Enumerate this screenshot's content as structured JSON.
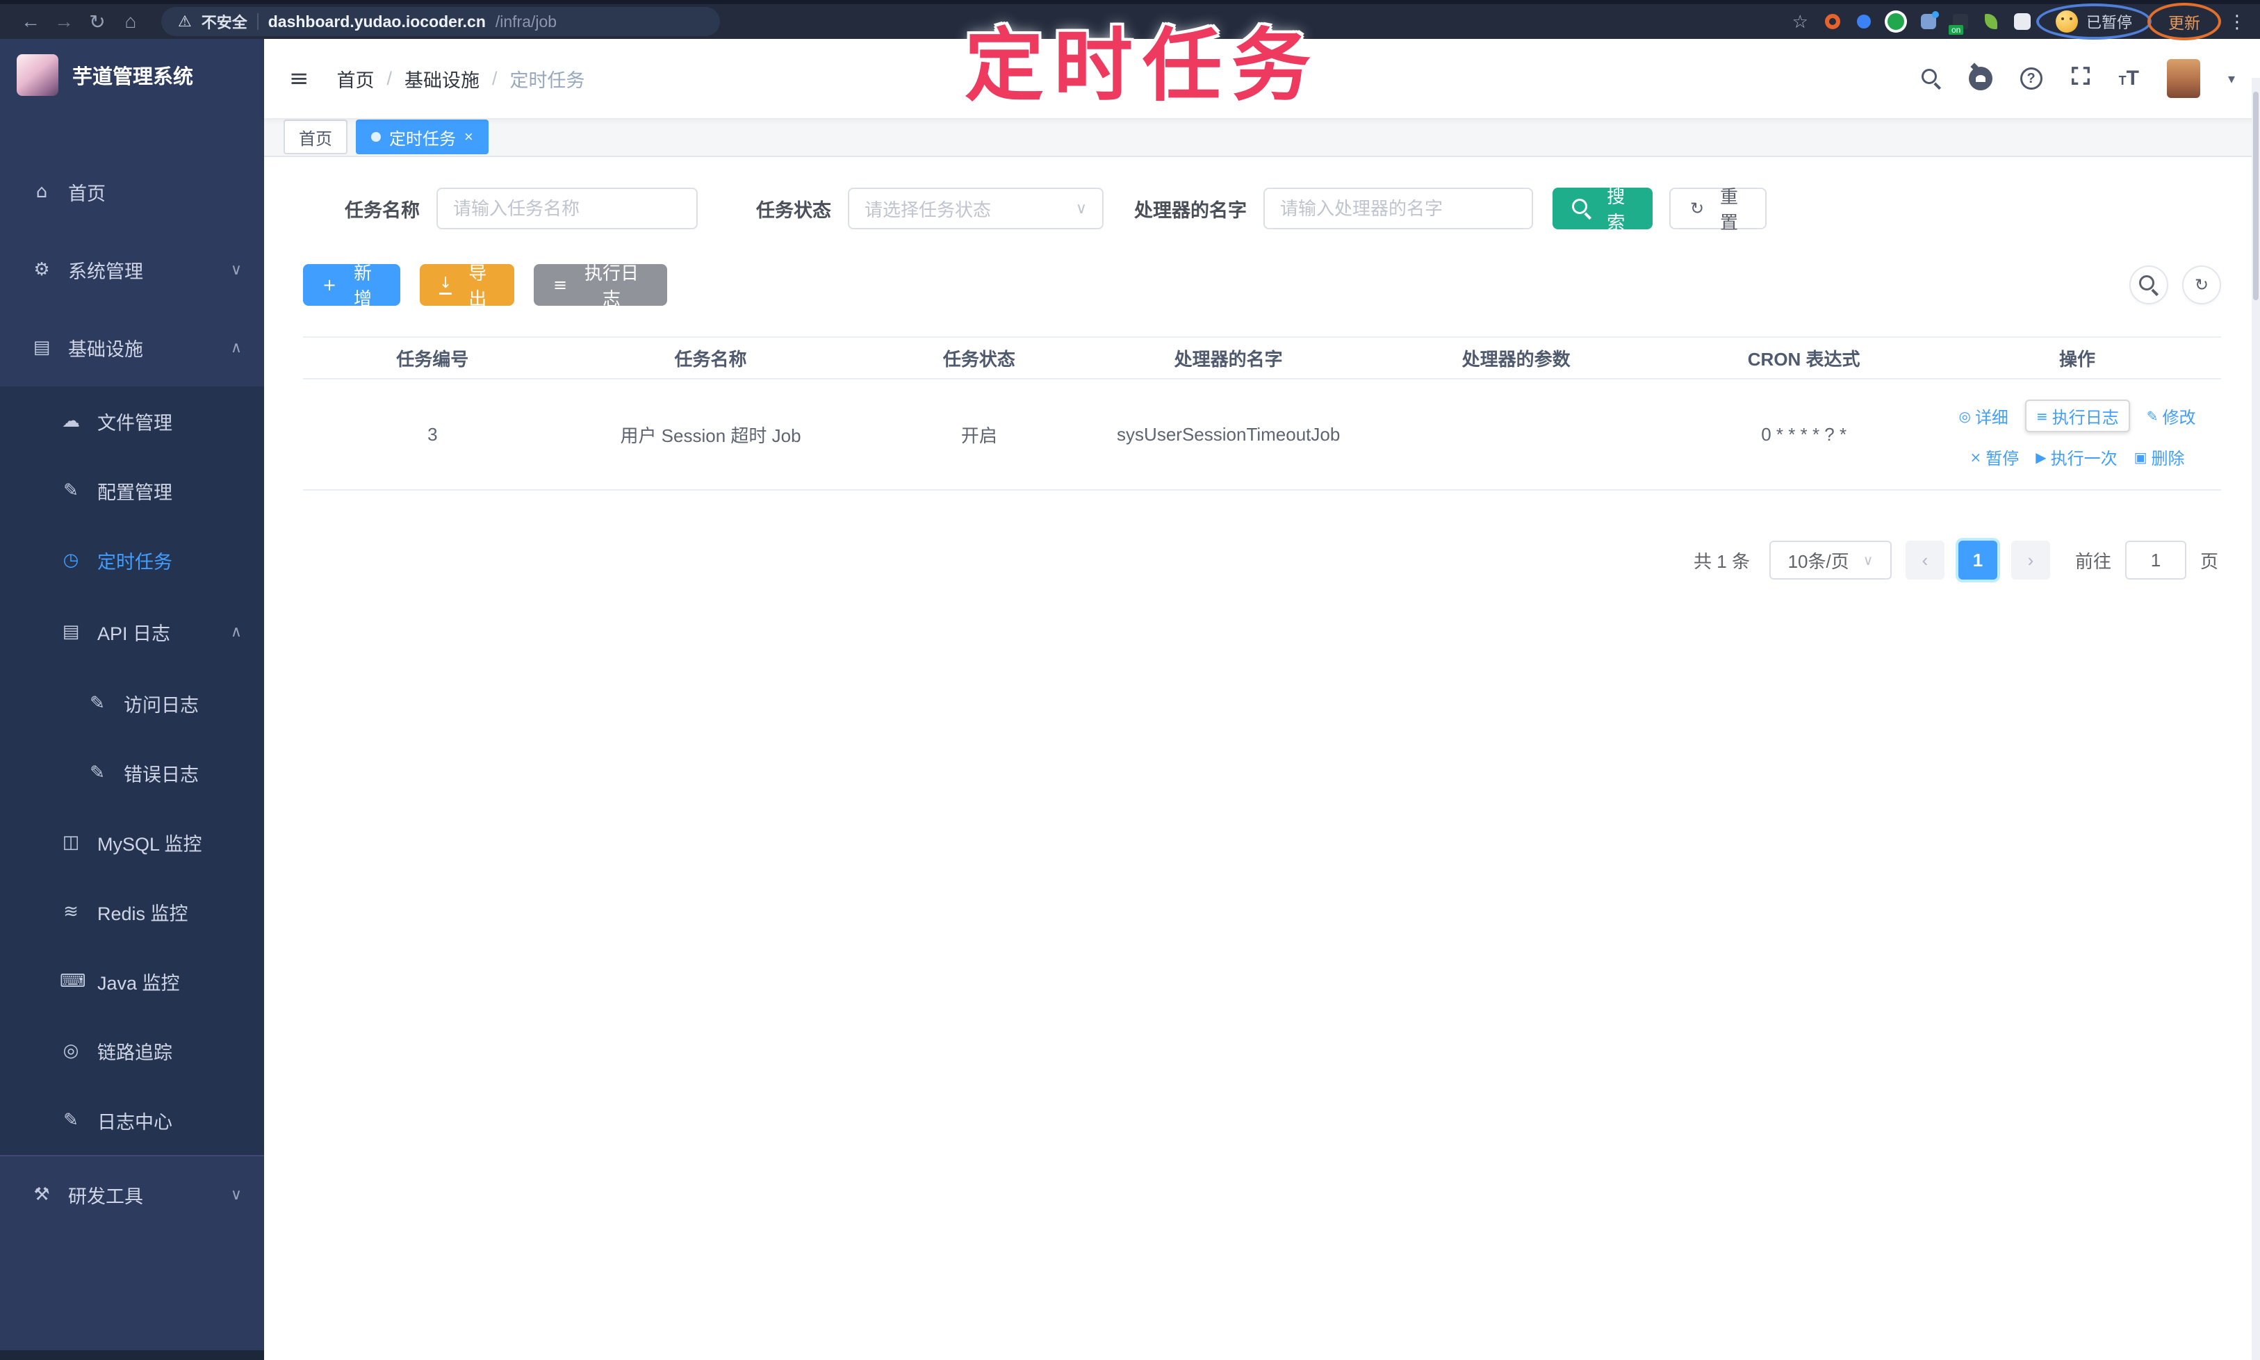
{
  "annotation": {
    "title": "定时任务"
  },
  "browser": {
    "back": "←",
    "forward": "→",
    "reload": "↻",
    "home": "⌂",
    "warning_glyph": "⚠",
    "security": "不安全",
    "host": "dashboard.yudao.iocoder.cn",
    "path": "/infra/job",
    "star_glyph": "☆",
    "ext_badge": "on",
    "profile_badge": "已暂停",
    "update_label": "更新",
    "menu_glyph": "⋮"
  },
  "sidebar": {
    "title": "芋道管理系统",
    "items": [
      {
        "label": "首页",
        "icon": "home-icon",
        "glyph": "⌂",
        "chevron": ""
      },
      {
        "label": "系统管理",
        "icon": "gear-icon",
        "glyph": "⚙",
        "chevron": "∨"
      },
      {
        "label": "基础设施",
        "icon": "infra-icon",
        "glyph": "▤",
        "chevron": "∧"
      },
      {
        "label": "文件管理",
        "icon": "cloud-icon",
        "glyph": "☁",
        "chevron": ""
      },
      {
        "label": "配置管理",
        "icon": "edit-icon",
        "glyph": "✎",
        "chevron": ""
      },
      {
        "label": "定时任务",
        "icon": "timer-icon",
        "glyph": "◷",
        "chevron": ""
      },
      {
        "label": "API 日志",
        "icon": "doc-log-icon",
        "glyph": "▤",
        "chevron": "∧"
      },
      {
        "label": "访问日志",
        "icon": "access-log-icon",
        "glyph": "✎",
        "chevron": ""
      },
      {
        "label": "错误日志",
        "icon": "error-log-icon",
        "glyph": "✎",
        "chevron": ""
      },
      {
        "label": "MySQL 监控",
        "icon": "mysql-icon",
        "glyph": "◫",
        "chevron": ""
      },
      {
        "label": "Redis 监控",
        "icon": "redis-icon",
        "glyph": "≋",
        "chevron": ""
      },
      {
        "label": "Java 监控",
        "icon": "java-icon",
        "glyph": "⌨",
        "chevron": ""
      },
      {
        "label": "链路追踪",
        "icon": "trace-icon",
        "glyph": "◎",
        "chevron": ""
      },
      {
        "label": "日志中心",
        "icon": "log-center-icon",
        "glyph": "✎",
        "chevron": ""
      },
      {
        "label": "研发工具",
        "icon": "tools-icon",
        "glyph": "⚒",
        "chevron": "∨"
      }
    ]
  },
  "header": {
    "breadcrumb": [
      "首页",
      "基础设施",
      "定时任务"
    ],
    "separator": "/"
  },
  "tabs": {
    "home": "首页",
    "active": "定时任务",
    "close_glyph": "×"
  },
  "filters": {
    "name_label": "任务名称",
    "name_placeholder": "请输入任务名称",
    "status_label": "任务状态",
    "status_placeholder": "请选择任务状态",
    "handler_label": "处理器的名字",
    "handler_placeholder": "请输入处理器的名字",
    "search": "搜索",
    "reset": "重置",
    "reset_glyph": "↻",
    "select_caret": "∨"
  },
  "toolbar": {
    "add": "新增",
    "add_glyph": "+",
    "export": "导出",
    "export_glyph": "↓",
    "log": "执行日志",
    "log_glyph": "≡",
    "refresh_glyph": "↻"
  },
  "table": {
    "headers": [
      "任务编号",
      "任务名称",
      "任务状态",
      "处理器的名字",
      "处理器的参数",
      "CRON 表达式",
      "操作"
    ],
    "row": {
      "id": "3",
      "name": "用户 Session 超时 Job",
      "status": "开启",
      "handler": "sysUserSessionTimeoutJob",
      "param": "",
      "cron": "0 * * * * ? *"
    },
    "ops": [
      {
        "label": "详细",
        "glyph": "◎"
      },
      {
        "label": "执行日志",
        "glyph": "≡"
      },
      {
        "label": "修改",
        "glyph": "✎"
      },
      {
        "label": "暂停",
        "glyph": "×"
      },
      {
        "label": "执行一次",
        "glyph": "▶"
      },
      {
        "label": "删除",
        "glyph": "▣"
      }
    ]
  },
  "pagination": {
    "total": "共 1 条",
    "page_size": "10条/页",
    "prev": "‹",
    "next": "›",
    "page": "1",
    "goto": "前往",
    "goto_value": "1",
    "page_unit": "页"
  },
  "colors": {
    "accent": "#409eff",
    "search_teal": "#1fae8c",
    "warning": "#f0a633",
    "info": "#909399",
    "annotation_pink": "#ee3a5e"
  }
}
